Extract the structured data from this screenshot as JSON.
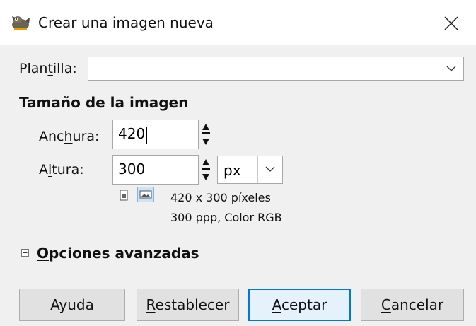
{
  "window": {
    "title": "Crear una imagen nueva",
    "app_icon": "gimp-icon",
    "close_icon": "close-icon"
  },
  "template": {
    "label_pre": "Plan",
    "label_mnemonic": "t",
    "label_post": "illa:",
    "value": ""
  },
  "image_size": {
    "title": "Tamaño de la imagen",
    "width": {
      "label_pre": "Anc",
      "label_mnemonic": "h",
      "label_post": "ura:",
      "value": "420"
    },
    "height": {
      "label_pre": "A",
      "label_mnemonic": "l",
      "label_post": "tura:",
      "value": "300"
    },
    "unit": "px",
    "info_line1": "420 x 300 píxeles",
    "info_line2": "300 ppp, Color RGB",
    "orientation_icons": [
      "portrait-icon",
      "landscape-icon"
    ]
  },
  "advanced": {
    "mnemonic": "O",
    "label_rest": "pciones avanzadas",
    "expander_icon": "expand-plus-icon"
  },
  "buttons": {
    "help": "Ayuda",
    "reset_mnemonic": "R",
    "reset_rest": "establecer",
    "accept_mnemonic": "A",
    "accept_rest": "ceptar",
    "cancel_mnemonic": "C",
    "cancel_rest": "ancelar"
  },
  "colors": {
    "accent": "#0078d7",
    "window_bg": "#f0f0f0"
  }
}
